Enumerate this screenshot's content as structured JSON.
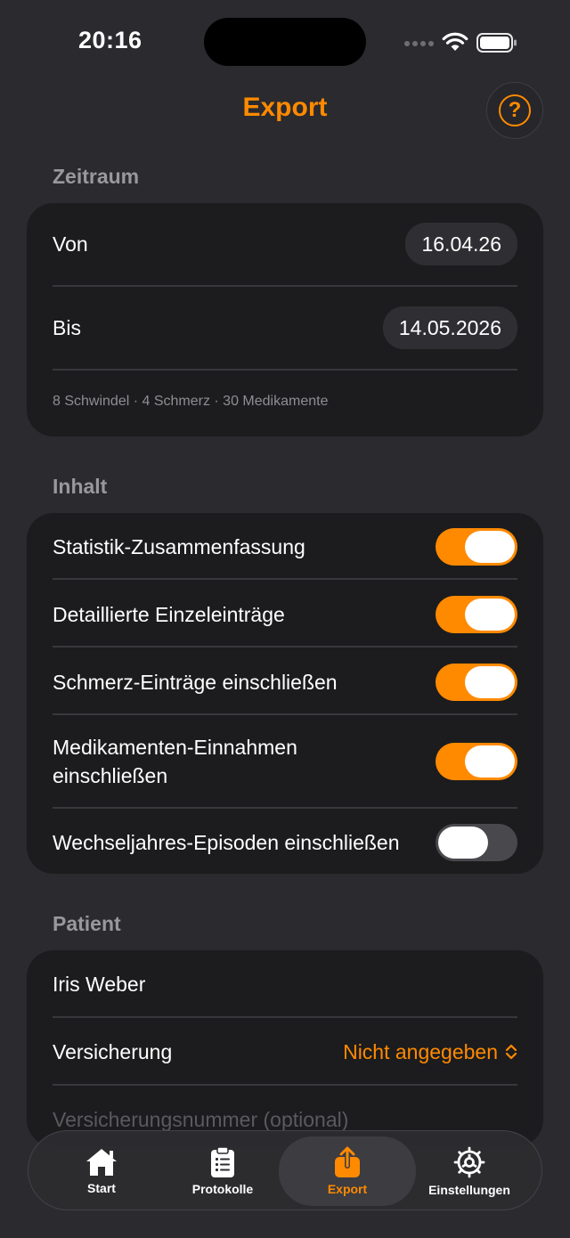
{
  "status_bar": {
    "time": "20:16"
  },
  "header": {
    "title": "Export",
    "help_label": "?"
  },
  "zeitraum": {
    "title": "Zeitraum",
    "from_label": "Von",
    "from_value": "16.04.26",
    "to_label": "Bis",
    "to_value": "14.05.2026",
    "summary": "8 Schwindel · 4 Schmerz · 30 Medikamente"
  },
  "inhalt": {
    "title": "Inhalt",
    "items": [
      {
        "label": "Statistik-Zusammenfassung",
        "on": true
      },
      {
        "label": "Detaillierte Einzeleinträge",
        "on": true
      },
      {
        "label": "Schmerz-Einträge einschließen",
        "on": true
      },
      {
        "label": "Medikamenten-Einnahmen einschließen",
        "line1": "Medikamenten-Einnahmen",
        "line2": "einschließen",
        "on": true
      },
      {
        "label": "Wechseljahres-Episoden einschließen",
        "on": false
      }
    ]
  },
  "patient": {
    "title": "Patient",
    "name": "Iris Weber",
    "insurance_label": "Versicherung",
    "insurance_value": "Nicht angegeben",
    "insurance_number_placeholder": "Versicherungsnummer (optional)"
  },
  "tabbar": {
    "tabs": [
      {
        "label": "Start",
        "icon": "house-icon"
      },
      {
        "label": "Protokolle",
        "icon": "clipboard-icon"
      },
      {
        "label": "Export",
        "icon": "share-icon",
        "active": true
      },
      {
        "label": "Einstellungen",
        "icon": "gear-icon"
      }
    ]
  },
  "colors": {
    "accent": "#ff8a00",
    "background": "#2a2a2f",
    "card": "#1c1c1e"
  }
}
